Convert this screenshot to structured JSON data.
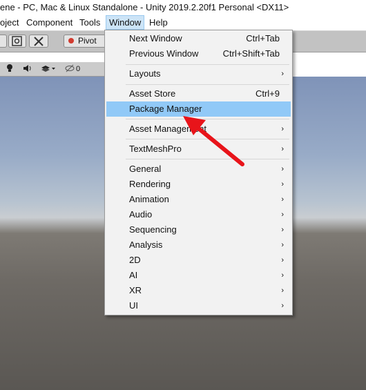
{
  "window": {
    "title": "ene - PC, Mac & Linux Standalone - Unity 2019.2.20f1 Personal <DX11>"
  },
  "menubar": {
    "items": [
      {
        "label": "oject"
      },
      {
        "label": "Component"
      },
      {
        "label": "Tools"
      },
      {
        "label": "Window"
      },
      {
        "label": "Help"
      }
    ],
    "active": "Window"
  },
  "toolbar": {
    "pivot_label": "Pivot"
  },
  "scene_toolbar": {
    "hidden_count": "0"
  },
  "window_menu": {
    "items": [
      {
        "label": "Next Window",
        "shortcut": "Ctrl+Tab"
      },
      {
        "label": "Previous Window",
        "shortcut": "Ctrl+Shift+Tab"
      },
      {
        "label": "Layouts",
        "submenu": true
      },
      {
        "label": "Asset Store",
        "shortcut": "Ctrl+9"
      },
      {
        "label": "Package Manager",
        "highlighted": true
      },
      {
        "label": "Asset Management",
        "submenu": true
      },
      {
        "label": "TextMeshPro",
        "submenu": true
      },
      {
        "label": "General",
        "submenu": true
      },
      {
        "label": "Rendering",
        "submenu": true
      },
      {
        "label": "Animation",
        "submenu": true
      },
      {
        "label": "Audio",
        "submenu": true
      },
      {
        "label": "Sequencing",
        "submenu": true
      },
      {
        "label": "Analysis",
        "submenu": true
      },
      {
        "label": "2D",
        "submenu": true
      },
      {
        "label": "AI",
        "submenu": true
      },
      {
        "label": "XR",
        "submenu": true
      },
      {
        "label": "UI",
        "submenu": true
      }
    ],
    "submenu_glyph": "›"
  },
  "colors": {
    "highlight": "#91c9f7",
    "annotation_arrow": "#e8141a"
  }
}
